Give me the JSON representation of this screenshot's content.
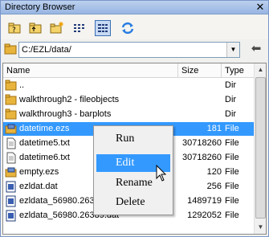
{
  "window": {
    "title": "Directory Browser",
    "close_glyph": "✕"
  },
  "path": {
    "value": "C:/EZL/data/"
  },
  "list": {
    "headers": {
      "name": "Name",
      "size": "Size",
      "type": "Type"
    },
    "rows": [
      {
        "icon": "folder-icon",
        "name": "..",
        "size": "",
        "type": "Dir"
      },
      {
        "icon": "folder-icon",
        "name": "walkthrough2 - fileobjects",
        "size": "",
        "type": "Dir"
      },
      {
        "icon": "folder-icon",
        "name": "walkthrough3 - barplots",
        "size": "",
        "type": "Dir"
      },
      {
        "icon": "ezs-file-icon",
        "name": "datetime.ezs",
        "size": "181",
        "type": "File"
      },
      {
        "icon": "text-file-icon",
        "name": "datetime5.txt",
        "size": "30718260",
        "type": "File"
      },
      {
        "icon": "text-file-icon",
        "name": "datetime6.txt",
        "size": "30718260",
        "type": "File"
      },
      {
        "icon": "ezs-file-icon",
        "name": "empty.ezs",
        "size": "120",
        "type": "File"
      },
      {
        "icon": "dat-file-icon",
        "name": "ezldat.dat",
        "size": "256",
        "type": "File"
      },
      {
        "icon": "dat-file-icon",
        "name": "ezldata_56980.26389.dat",
        "size": "1489719",
        "type": "File"
      },
      {
        "icon": "dat-file-icon",
        "name": "ezldata_56980.26389.dat",
        "size": "1292052",
        "type": "File"
      }
    ]
  },
  "context_menu": {
    "items": [
      "Run",
      "Edit",
      "Rename",
      "Delete"
    ],
    "hovered_item": "Edit"
  },
  "colors": {
    "selection": "#3399ff",
    "titlebar": "#a9c2e8",
    "folder": "#e8b43c"
  }
}
